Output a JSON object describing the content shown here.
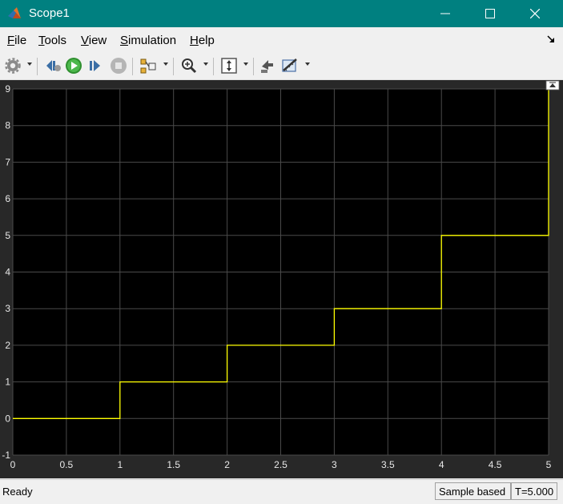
{
  "window": {
    "title": "Scope1"
  },
  "menu": {
    "items": [
      {
        "label": "File",
        "key": "F",
        "rest": "ile"
      },
      {
        "label": "Tools",
        "key": "T",
        "rest": "ools"
      },
      {
        "label": "View",
        "key": "V",
        "rest": "iew"
      },
      {
        "label": "Simulation",
        "key": "S",
        "rest": "imulation"
      },
      {
        "label": "Help",
        "key": "H",
        "rest": "elp"
      }
    ]
  },
  "toolbar": {
    "icons": [
      "gear-icon",
      "step-back-icon",
      "run-icon",
      "step-forward-icon",
      "stop-icon",
      "signal-selector-icon",
      "zoom-in-icon",
      "scale-axes-icon",
      "highlight-block-icon",
      "measurements-icon"
    ]
  },
  "status": {
    "text": "Ready",
    "mode": "Sample based",
    "time": "T=5.000"
  },
  "chart_data": {
    "type": "line",
    "x": [
      0,
      1,
      1,
      2,
      2,
      3,
      3,
      4,
      4,
      5,
      5
    ],
    "y": [
      0,
      0,
      1,
      1,
      2,
      2,
      3,
      3,
      5,
      5,
      9
    ],
    "xlim": [
      0,
      5
    ],
    "ylim": [
      -1,
      9
    ],
    "xticks": [
      "0",
      "0.5",
      "1",
      "1.5",
      "2",
      "2.5",
      "3",
      "3.5",
      "4",
      "4.5",
      "5"
    ],
    "yticks": [
      "-1",
      "0",
      "1",
      "2",
      "3",
      "4",
      "5",
      "6",
      "7",
      "8",
      "9"
    ],
    "grid": true,
    "line_color": "#ffff00",
    "background": "#000000"
  }
}
